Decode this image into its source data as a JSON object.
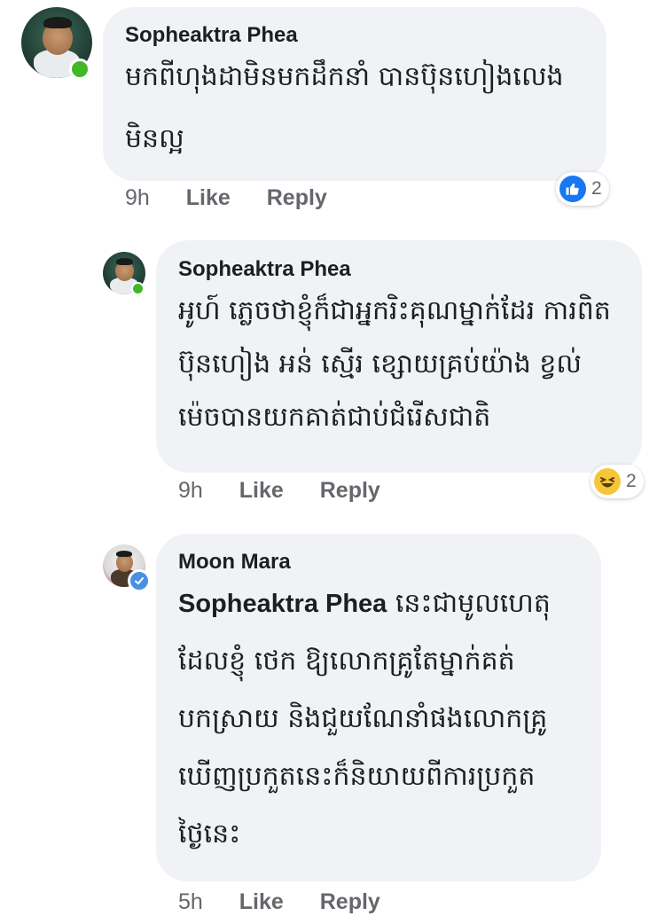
{
  "comments": [
    {
      "author": "Sopheaktra Phea",
      "lines": [
        "មកពីហុងដាមិនមកដឹកនាំ បានប៊ុនហៀងលេង",
        "មិនល្អ"
      ],
      "time": "9h",
      "like_label": "Like",
      "reply_label": "Reply",
      "reaction": {
        "type": "like",
        "count": "2"
      },
      "online": true
    },
    {
      "author": "Sopheaktra Phea",
      "lines": [
        "អូហ៍ ភ្លេចថាខ្ញុំក៏ជាអ្នករិះគុណម្នាក់ដែរ ការពិត",
        "ប៊ុនហៀង អន់ ស្មើរ ខ្សោយគ្រប់យ៉ាង ខ្វល់",
        "ម៉េចបានយកគាត់ជាប់ជំរើសជាតិ"
      ],
      "time": "9h",
      "like_label": "Like",
      "reply_label": "Reply",
      "reaction": {
        "type": "haha",
        "count": "2"
      },
      "online": true
    },
    {
      "author": "Moon Mara",
      "mention": "Sopheaktra Phea",
      "lines": [
        " នេះជាមូលហេតុ",
        "ដែលខ្ញុំ ថេក ឱ្យលោកគ្រូតែម្នាក់គត់",
        "បកស្រាយ និងជួយណែនាំផងលោកគ្រូ",
        "ឃើញប្រកួតនេះក៏និយាយពីការប្រកួត",
        "ថ្ងៃនេះ"
      ],
      "time": "5h",
      "like_label": "Like",
      "reply_label": "Reply",
      "verified": true
    }
  ],
  "colors": {
    "bubble": "#f0f2f5",
    "meta": "#65676b",
    "like_blue": "#1877f2",
    "online_green": "#42b72a",
    "verified_blue": "#4a90e2"
  },
  "icons": {
    "like": "thumbs-up-icon",
    "haha": "laughing-emoji-icon",
    "verified": "verified-check-icon"
  }
}
